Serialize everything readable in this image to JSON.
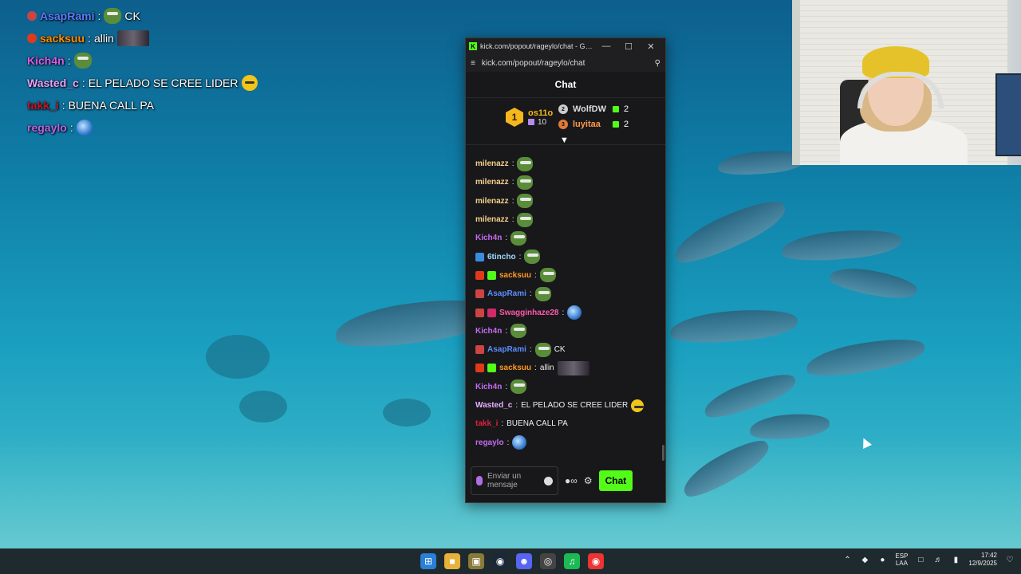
{
  "overlay_chat": [
    {
      "user": "AsapRami",
      "color": "#5c7cff",
      "text": "CK",
      "emote": "pepe",
      "badge": "#c44"
    },
    {
      "user": "sacksuu",
      "color": "#ff8c00",
      "text": "allin",
      "emote": "photo",
      "badge": "#e03a1a"
    },
    {
      "user": "Kich4n",
      "color": "#d45de8",
      "text": "",
      "emote": "pepe",
      "badge": ""
    },
    {
      "user": "Wasted_c",
      "color": "#e9a0ff",
      "text": "EL PELADO SE CREE LIDER",
      "emote": "yellow",
      "badge": ""
    },
    {
      "user": "takk_i",
      "color": "#c0182e",
      "text": "BUENA CALL PA",
      "emote": "",
      "badge": ""
    },
    {
      "user": "regaylo",
      "color": "#b466e8",
      "text": "",
      "emote": "globe",
      "badge": ""
    }
  ],
  "window": {
    "title": "kick.com/popout/rageylo/chat - Googl...",
    "url": "kick.com/popout/rageylo/chat",
    "logo": "K"
  },
  "chat": {
    "header": "Chat",
    "leaderboard": {
      "first": {
        "rank": "1",
        "name": "os11o",
        "count": "10"
      },
      "second": {
        "rank": "2",
        "name": "WolfDW",
        "count": "2"
      },
      "third": {
        "rank": "3",
        "name": "luyitaa",
        "count": "2"
      }
    },
    "messages": [
      {
        "user": "milenazz",
        "color": "#f5d08a",
        "text": "",
        "emote": "pepe",
        "badges": []
      },
      {
        "user": "milenazz",
        "color": "#f5d08a",
        "text": "",
        "emote": "pepe",
        "badges": []
      },
      {
        "user": "milenazz",
        "color": "#f5d08a",
        "text": "",
        "emote": "pepe",
        "badges": []
      },
      {
        "user": "milenazz",
        "color": "#f5d08a",
        "text": "",
        "emote": "pepe",
        "badges": []
      },
      {
        "user": "Kich4n",
        "color": "#c56cf0",
        "text": "",
        "emote": "pepe",
        "badges": []
      },
      {
        "user": "6tincho",
        "color": "#9edbff",
        "text": "",
        "emote": "pepe",
        "badges": [
          "#3a8dde"
        ]
      },
      {
        "user": "sacksuu",
        "color": "#ff9a1f",
        "text": "",
        "emote": "pepe",
        "badges": [
          "#e03a1a",
          "#53fc18"
        ]
      },
      {
        "user": "AsapRami",
        "color": "#5c8cff",
        "text": "",
        "emote": "pepe",
        "badges": [
          "#c44"
        ]
      },
      {
        "user": "Swagginhaze28",
        "color": "#ff5aa8",
        "text": "",
        "emote": "globe",
        "badges": [
          "#c44",
          "#d02a6a"
        ]
      },
      {
        "user": "Kich4n",
        "color": "#c56cf0",
        "text": "",
        "emote": "pepe",
        "badges": []
      },
      {
        "user": "AsapRami",
        "color": "#5c8cff",
        "text": "CK",
        "emote": "pepe",
        "badges": [
          "#c44"
        ]
      },
      {
        "user": "sacksuu",
        "color": "#ff9a1f",
        "text": "allin",
        "emote": "photo",
        "badges": [
          "#e03a1a",
          "#53fc18"
        ]
      },
      {
        "user": "Kich4n",
        "color": "#c56cf0",
        "text": "",
        "emote": "pepe",
        "badges": []
      },
      {
        "user": "Wasted_c",
        "color": "#e9b0ff",
        "text": "EL PELADO SE CREE LIDER",
        "emote": "yellow",
        "badges": []
      },
      {
        "user": "takk_i",
        "color": "#e0203e",
        "text": "BUENA CALL PA",
        "emote": "",
        "badges": []
      },
      {
        "user": "regaylo",
        "color": "#c56cf0",
        "text": "",
        "emote": "globe",
        "badges": []
      }
    ],
    "input_placeholder": "Enviar un mensaje",
    "send_label": "Chat"
  },
  "taskbar": {
    "language": "ESP",
    "language_sub": "LAA",
    "time": "17:42",
    "date": "12/9/2025"
  }
}
